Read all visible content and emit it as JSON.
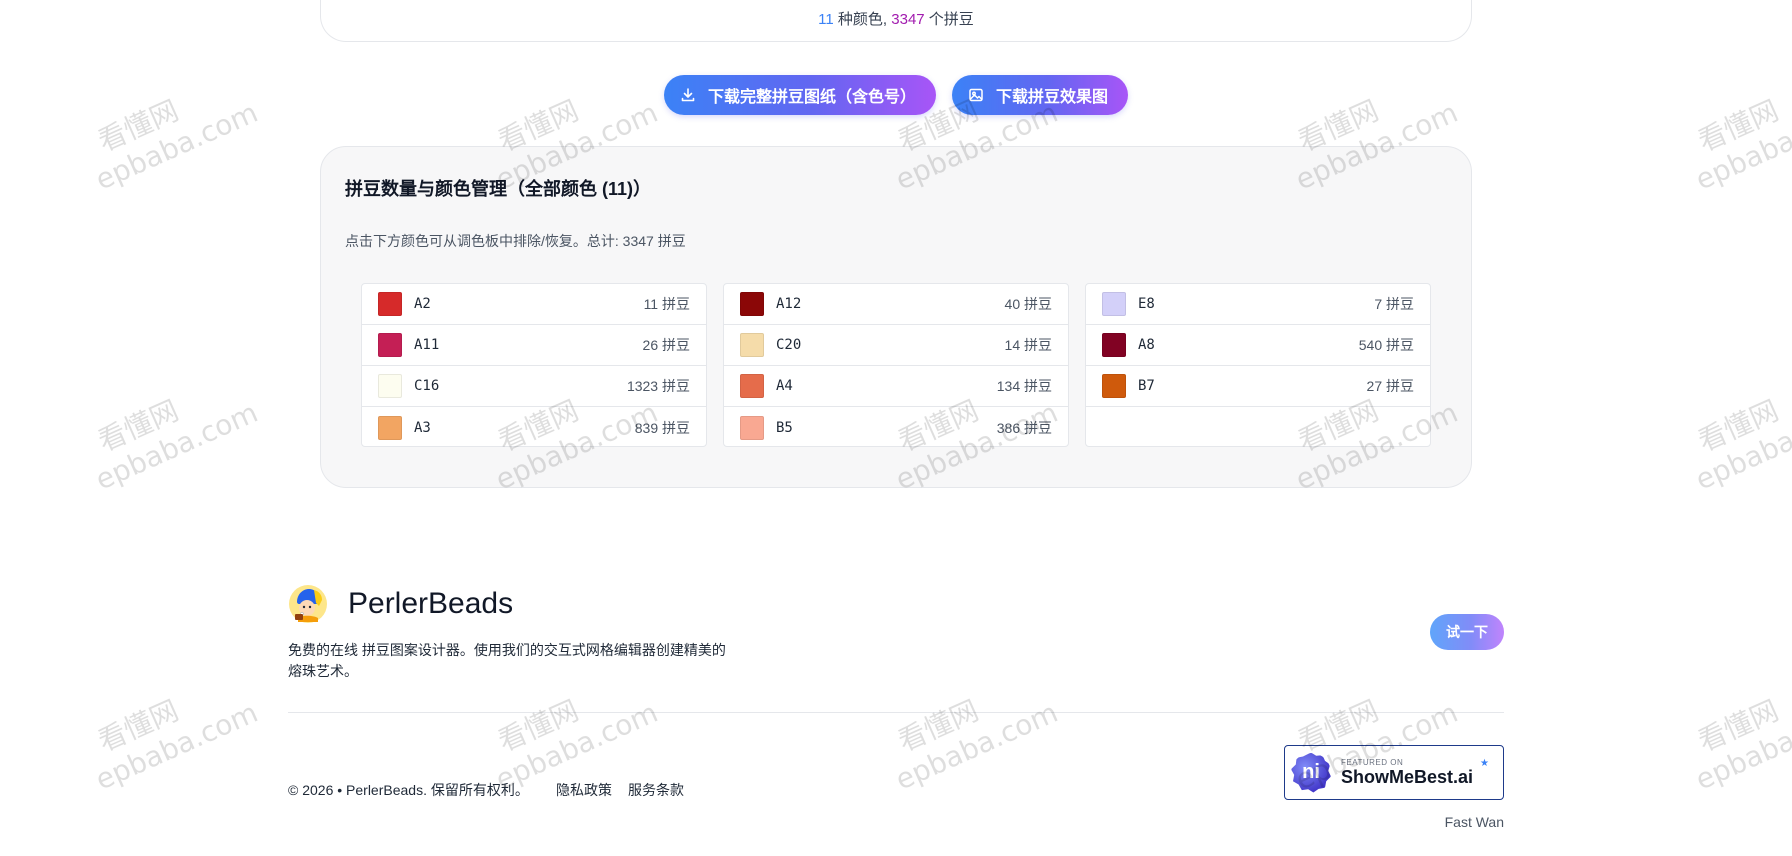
{
  "summary": {
    "color_count": "11",
    "color_label": " 种颜色, ",
    "bead_count": "3347",
    "bead_label": " 个拼豆"
  },
  "actions": {
    "download_pattern_label": "下载完整拼豆图纸（含色号）",
    "download_effect_label": "下载拼豆效果图",
    "download_icon": "download-icon",
    "image_icon": "image-icon"
  },
  "stats": {
    "title": "拼豆数量与颜色管理（全部颜色 (11)）",
    "hint": "点击下方颜色可从调色板中排除/恢复。总计: 3347 拼豆",
    "columns": [
      [
        {
          "code": "A2",
          "count": "11 拼豆",
          "color": "#d62a2a"
        },
        {
          "code": "A11",
          "count": "26 拼豆",
          "color": "#c41f55"
        },
        {
          "code": "C16",
          "count": "1323 拼豆",
          "color": "#fdfdf0"
        },
        {
          "code": "A3",
          "count": "839 拼豆",
          "color": "#f2a562"
        }
      ],
      [
        {
          "code": "A12",
          "count": "40 拼豆",
          "color": "#8b0707"
        },
        {
          "code": "C20",
          "count": "14 拼豆",
          "color": "#f5dcaa"
        },
        {
          "code": "A4",
          "count": "134 拼豆",
          "color": "#e56c4b"
        },
        {
          "code": "B5",
          "count": "386 拼豆",
          "color": "#f9a892"
        }
      ],
      [
        {
          "code": "E8",
          "count": "7 拼豆",
          "color": "#d3d0f9"
        },
        {
          "code": "A8",
          "count": "540 拼豆",
          "color": "#810223"
        },
        {
          "code": "B7",
          "count": "27 拼豆",
          "color": "#cf5a0c"
        }
      ]
    ]
  },
  "footer": {
    "brand_name": "PerlerBeads",
    "description": "免费的在线 拼豆图案设计器。使用我们的交互式网格编辑器创建精美的熔珠艺术。",
    "try_label": "试一下",
    "copyright": "© 2026 • PerlerBeads. 保留所有权利。",
    "privacy_label": "隐私政策",
    "terms_label": "服务条款",
    "badge_featured": "FEATURED ON",
    "badge_name": "ShowMeBest.ai",
    "badge_logo_text": "ni",
    "author": "Fast Wan"
  },
  "watermark": {
    "cn": "看懂网",
    "en": "epbaba.com"
  },
  "colors": {
    "accent_blue": "#3b82f6",
    "accent_purple": "#a855f7"
  }
}
